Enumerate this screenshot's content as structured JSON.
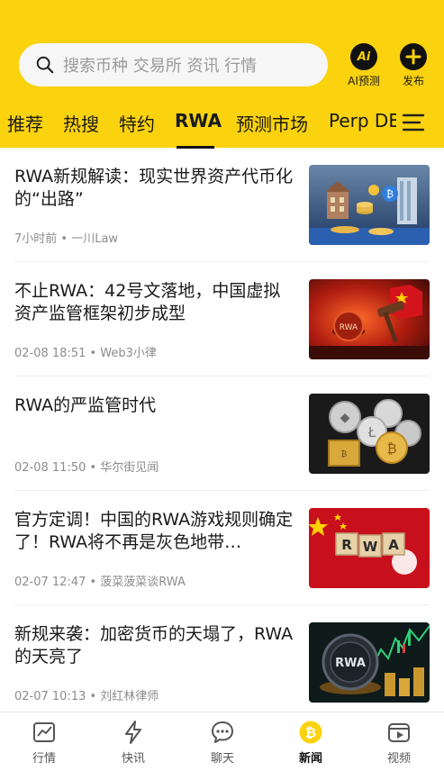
{
  "header": {
    "search_placeholder": "搜索币种 交易所 资讯 行情",
    "ai_button_label": "AI预测",
    "ai_icon_text": "Ai",
    "post_button_label": "发布"
  },
  "tabs": [
    "推荐",
    "热搜",
    "特约",
    "RWA",
    "预测市场",
    "Perp DE"
  ],
  "active_tab": "RWA",
  "news": [
    {
      "title": "RWA新规解读：现实世界资产代币化的“出路”",
      "meta": "7小时前 • 一川Law",
      "image": "buildings-coins"
    },
    {
      "title": "不止RWA：42号文落地，中国虚拟资产监管框架初步成型",
      "meta": "02-08 18:51 • Web3小律",
      "image": "gavel-flag"
    },
    {
      "title": "RWA的严监管时代",
      "meta": "02-08 11:50 • 华尔街见闻",
      "image": "crypto-coins"
    },
    {
      "title": "官方定调！中国的RWA游戏规则确定了！RWA将不再是灰色地带…",
      "meta": "02-07 12:47 • 菠菜菠菜谈RWA",
      "image": "rwa-blocks-flags"
    },
    {
      "title": "新规来袭：加密货币的天塌了，RWA的天亮了",
      "meta": "02-07 10:13 • 刘红林律师",
      "image": "rwa-coin-chart"
    }
  ],
  "bottom_nav": [
    {
      "label": "行情",
      "icon": "chart-icon"
    },
    {
      "label": "快讯",
      "icon": "lightning-icon"
    },
    {
      "label": "聊天",
      "icon": "chat-icon"
    },
    {
      "label": "新闻",
      "icon": "bitcoin-icon",
      "active": true
    },
    {
      "label": "视频",
      "icon": "video-icon"
    }
  ],
  "colors": {
    "brand_yellow": "#FAD20E",
    "text_primary": "#1a1a1a",
    "text_meta": "#8c8c8c"
  }
}
